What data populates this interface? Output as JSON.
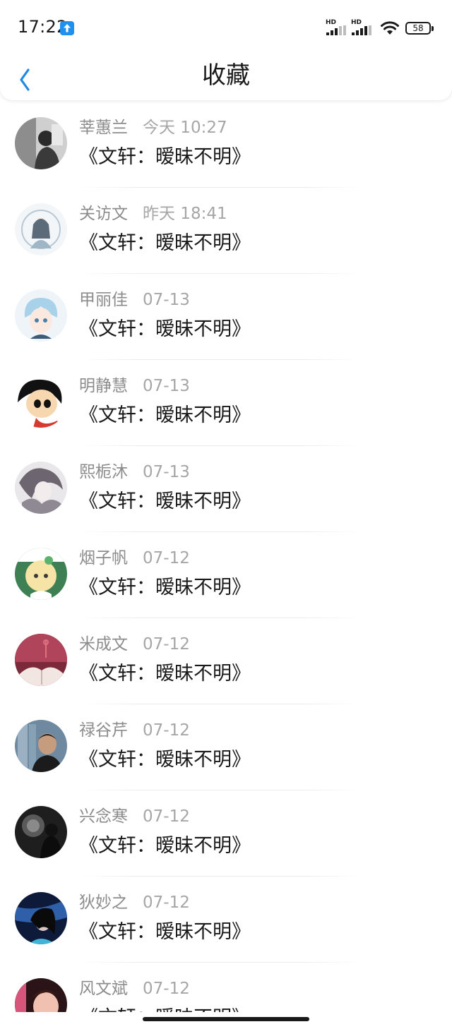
{
  "status_bar": {
    "time": "17:22",
    "signal_1_label": "HD",
    "signal_2_label": "HD",
    "battery": "58",
    "upload_icon": "upload-arrow-icon",
    "wifi_icon": "wifi-icon"
  },
  "nav": {
    "title": "收藏",
    "back_icon": "chevron-left-icon"
  },
  "colors": {
    "accent": "#1e88e5",
    "name_text": "#8c8c8c",
    "time_text": "#a6a6a6",
    "title_text": "#1a1a1a"
  },
  "favorites": [
    {
      "name": "莘蕙兰",
      "time": "今天 10:27",
      "title": "《文轩：暧昧不明》"
    },
    {
      "name": "关访文",
      "time": "昨天 18:41",
      "title": "《文轩：暧昧不明》"
    },
    {
      "name": "甲丽佳",
      "time": "07-13",
      "title": "《文轩：暧昧不明》"
    },
    {
      "name": "明静慧",
      "time": "07-13",
      "title": "《文轩：暧昧不明》"
    },
    {
      "name": "熙栀沐",
      "time": "07-13",
      "title": "《文轩：暧昧不明》"
    },
    {
      "name": "烟子帆",
      "time": "07-12",
      "title": "《文轩：暧昧不明》"
    },
    {
      "name": "米成文",
      "time": "07-12",
      "title": "《文轩：暧昧不明》"
    },
    {
      "name": "禄谷芹",
      "time": "07-12",
      "title": "《文轩：暧昧不明》"
    },
    {
      "name": "兴念寒",
      "time": "07-12",
      "title": "《文轩：暧昧不明》"
    },
    {
      "name": "狄妙之",
      "time": "07-12",
      "title": "《文轩：暧昧不明》"
    },
    {
      "name": "风文斌",
      "time": "07-12",
      "title": "《文轩：暧昧不明》"
    }
  ]
}
